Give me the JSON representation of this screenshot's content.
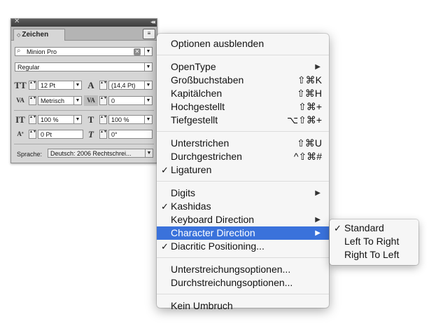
{
  "panel": {
    "close_glyph": "✕",
    "collapse_glyph": "◂◂",
    "tab_arrows": "◇",
    "tab_label": "Zeichen",
    "menu_glyph": "≡",
    "font_family": "Minion Pro",
    "font_style": "Regular",
    "font_size": "12 Pt",
    "leading": "(14,4 Pt)",
    "kerning": "Metrisch",
    "tracking": "0",
    "vertical_scale": "100 %",
    "horizontal_scale": "100 %",
    "baseline_shift": "0 Pt",
    "skew": "0°",
    "language_label": "Sprache:",
    "language_value": "Deutsch: 2006 Rechtschrei..."
  },
  "icons": {
    "dropdown": "▼",
    "stepper": "▲▼",
    "clear": "✕",
    "size": "TT",
    "leading": "A",
    "kerning": "VA",
    "tracking": "VA",
    "vscale": "IT",
    "hscale": "T",
    "baseline": "Aª",
    "skew": "T"
  },
  "menu": {
    "groups": [
      [
        {
          "label": "Optionen ausblenden",
          "shortcut": "",
          "check": "",
          "submenu": ""
        }
      ],
      [
        {
          "label": "OpenType",
          "shortcut": "",
          "check": "",
          "submenu": "▶"
        },
        {
          "label": "Großbuchstaben",
          "shortcut": "⇧⌘K",
          "check": "",
          "submenu": ""
        },
        {
          "label": "Kapitälchen",
          "shortcut": "⇧⌘H",
          "check": "",
          "submenu": ""
        },
        {
          "label": "Hochgestellt",
          "shortcut": "⇧⌘+",
          "check": "",
          "submenu": ""
        },
        {
          "label": "Tiefgestellt",
          "shortcut": "⌥⇧⌘+",
          "check": "",
          "submenu": ""
        }
      ],
      [
        {
          "label": "Unterstrichen",
          "shortcut": "⇧⌘U",
          "check": "",
          "submenu": ""
        },
        {
          "label": "Durchgestrichen",
          "shortcut": "^⇧⌘#",
          "check": "",
          "submenu": ""
        },
        {
          "label": "Ligaturen",
          "shortcut": "",
          "check": "✓",
          "submenu": ""
        }
      ],
      [
        {
          "label": "Digits",
          "shortcut": "",
          "check": "",
          "submenu": "▶"
        },
        {
          "label": "Kashidas",
          "shortcut": "",
          "check": "✓",
          "submenu": ""
        },
        {
          "label": "Keyboard Direction",
          "shortcut": "",
          "check": "",
          "submenu": "▶"
        },
        {
          "label": "Character Direction",
          "shortcut": "",
          "check": "",
          "submenu": "▶"
        },
        {
          "label": "Diacritic Positioning...",
          "shortcut": "",
          "check": "✓",
          "submenu": ""
        }
      ],
      [
        {
          "label": "Unterstreichungsoptionen...",
          "shortcut": "",
          "check": "",
          "submenu": ""
        },
        {
          "label": "Durchstreichungsoptionen...",
          "shortcut": "",
          "check": "",
          "submenu": ""
        }
      ],
      [
        {
          "label": "Kein Umbruch",
          "shortcut": "",
          "check": "",
          "submenu": ""
        }
      ]
    ],
    "highlighted_label": "Character Direction"
  },
  "submenu": {
    "items": [
      {
        "label": "Standard",
        "check": "✓"
      },
      {
        "label": "Left To Right",
        "check": ""
      },
      {
        "label": "Right To Left",
        "check": ""
      }
    ]
  },
  "colors": {
    "highlight": "#3a72db",
    "menu_bg": "#f6f6f6",
    "panel_bg": "#d6d6d6"
  }
}
